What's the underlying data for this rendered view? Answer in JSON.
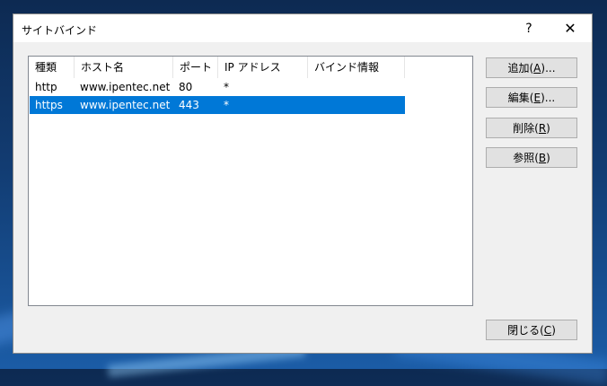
{
  "window": {
    "title": "サイトバインド",
    "help_glyph": "?",
    "close_glyph": "✕"
  },
  "list": {
    "columns": [
      "種類",
      "ホスト名",
      "ポート",
      "IP アドレス",
      "バインド情報"
    ],
    "rows": [
      {
        "type": "http",
        "host": "www.ipentec.net",
        "port": "80",
        "ip": "*",
        "binding": "",
        "selected": false
      },
      {
        "type": "https",
        "host": "www.ipentec.net",
        "port": "443",
        "ip": "*",
        "binding": "",
        "selected": true
      }
    ]
  },
  "buttons": {
    "add": {
      "pre": "追加(",
      "key": "A",
      "post": ")..."
    },
    "edit": {
      "pre": "編集(",
      "key": "E",
      "post": ")..."
    },
    "delete": {
      "pre": "削除(",
      "key": "R",
      "post": ")"
    },
    "browse": {
      "pre": "参照(",
      "key": "B",
      "post": ")"
    },
    "close": {
      "pre": "閉じる(",
      "key": "C",
      "post": ")"
    }
  },
  "colors": {
    "selection": "#0078d7",
    "dialog_bg": "#f0f0f0"
  }
}
